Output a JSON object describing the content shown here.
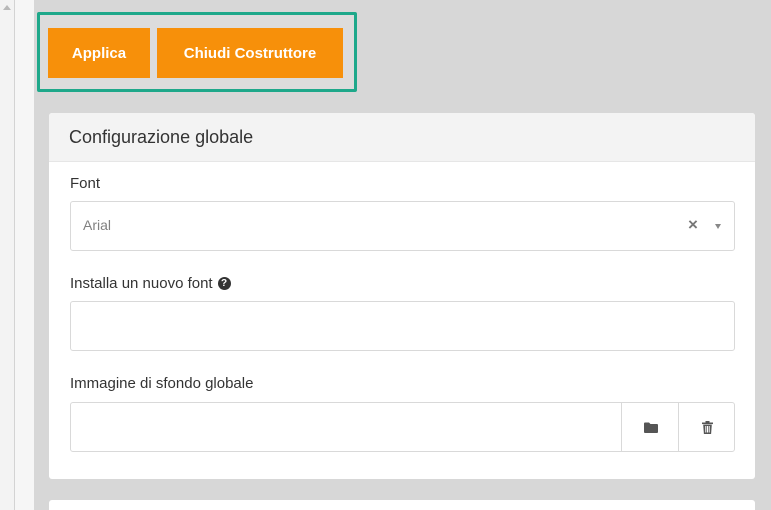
{
  "toolbar": {
    "apply_label": "Applica",
    "close_builder_label": "Chiudi Costruttore",
    "highlight_color": "#1ea88a",
    "button_color": "#f7900a"
  },
  "panel": {
    "title": "Configurazione globale",
    "font": {
      "label": "Font",
      "selected_value": "Arial",
      "clear_symbol": "×",
      "icons": [
        "clear-icon",
        "caret-down-icon"
      ]
    },
    "install_font": {
      "label": "Installa un nuovo font",
      "help_symbol": "?",
      "value": ""
    },
    "background_image": {
      "label": "Immagine di sfondo globale",
      "value": "",
      "icons": [
        "folder-icon",
        "trash-icon"
      ]
    }
  }
}
